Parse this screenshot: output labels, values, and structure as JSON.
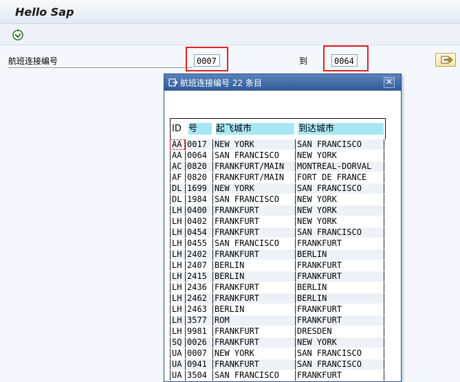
{
  "window": {
    "title": "Hello Sap"
  },
  "toolbar": {
    "execute_icon": "execute-icon"
  },
  "selection": {
    "field_label": "航班连接编号",
    "from_value": "0007",
    "to_label": "到",
    "to_value": "0064",
    "multi_select_icon": "multiple-selection-icon"
  },
  "highlight_color": "#e41f1f",
  "popup": {
    "title": "航班连接编号 22 条目",
    "columns": [
      "ID",
      "号",
      "起飞城市",
      "到达城市"
    ],
    "rows": [
      [
        "AA",
        "0017",
        "NEW YORK",
        "SAN FRANCISCO"
      ],
      [
        "AA",
        "0064",
        "SAN FRANCISCO",
        "NEW YORK"
      ],
      [
        "AC",
        "0820",
        "FRANKFURT/MAIN",
        "MONTREAL-DORVAL"
      ],
      [
        "AF",
        "0820",
        "FRANKFURT/MAIN",
        "FORT DE FRANCE"
      ],
      [
        "DL",
        "1699",
        "NEW YORK",
        "SAN FRANCISCO"
      ],
      [
        "DL",
        "1984",
        "SAN FRANCISCO",
        "NEW YORK"
      ],
      [
        "LH",
        "0400",
        "FRANKFURT",
        "NEW YORK"
      ],
      [
        "LH",
        "0402",
        "FRANKFURT",
        "NEW YORK"
      ],
      [
        "LH",
        "0454",
        "FRANKFURT",
        "SAN FRANCISCO"
      ],
      [
        "LH",
        "0455",
        "SAN FRANCISCO",
        "FRANKFURT"
      ],
      [
        "LH",
        "2402",
        "FRANKFURT",
        "BERLIN"
      ],
      [
        "LH",
        "2407",
        "BERLIN",
        "FRANKFURT"
      ],
      [
        "LH",
        "2415",
        "BERLIN",
        "FRANKFURT"
      ],
      [
        "LH",
        "2436",
        "FRANKFURT",
        "BERLIN"
      ],
      [
        "LH",
        "2462",
        "FRANKFURT",
        "BERLIN"
      ],
      [
        "LH",
        "2463",
        "BERLIN",
        "FRANKFURT"
      ],
      [
        "LH",
        "3577",
        "ROM",
        "FRANKFURT"
      ],
      [
        "LH",
        "9981",
        "FRANKFURT",
        "DRESDEN"
      ],
      [
        "SQ",
        "0026",
        "FRANKFURT",
        "NEW YORK"
      ],
      [
        "UA",
        "0007",
        "NEW YORK",
        "SAN FRANCISCO"
      ],
      [
        "UA",
        "0941",
        "FRANKFURT",
        "SAN FRANCISCO"
      ],
      [
        "UA",
        "3504",
        "SAN FRANCISCO",
        "FRANKFURT"
      ]
    ]
  }
}
